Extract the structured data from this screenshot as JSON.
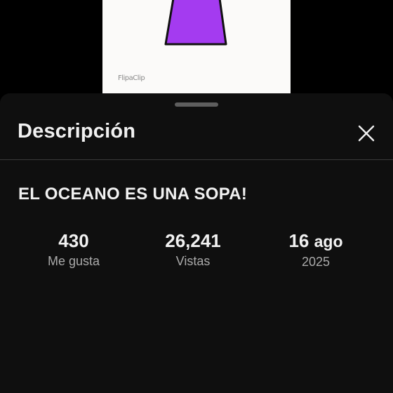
{
  "video_preview": {
    "watermark": "FlipaClip",
    "shape_color": "#a43bf0"
  },
  "description_panel": {
    "title": "Descripción",
    "close_icon": "close-icon",
    "video_title": "EL OCEANO ES UNA SOPA!",
    "stats": {
      "likes": {
        "value": "430",
        "label": "Me gusta"
      },
      "views": {
        "value": "26,241",
        "label": "Vistas"
      },
      "date": {
        "day": "16",
        "month": "ago",
        "year": "2025"
      }
    }
  },
  "colors": {
    "sheet_background": "#0f0f0f",
    "primary_text": "#f1f1f1",
    "secondary_text": "#aaaaaa"
  }
}
